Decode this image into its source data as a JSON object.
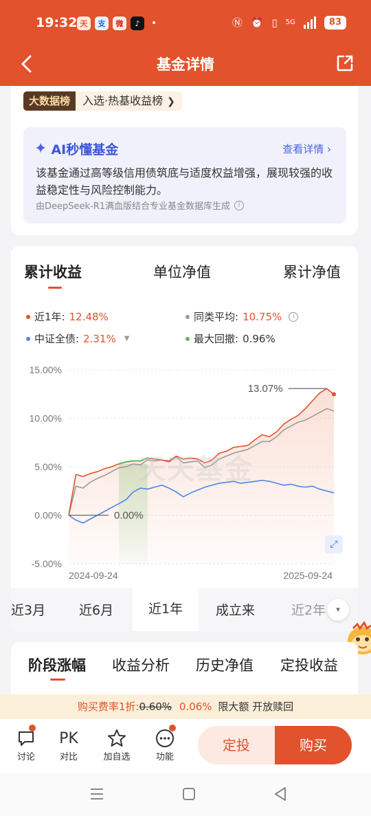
{
  "status_bar": {
    "time": "19:32",
    "network": "5G",
    "battery": "83"
  },
  "nav": {
    "title": "基金详情"
  },
  "ranking": {
    "badge": "大数据榜",
    "text": "入选·热基收益榜"
  },
  "ai": {
    "title": "AI秒懂基金",
    "more": "查看详情",
    "description": "该基金通过高等级信用债筑底与适度权益增强，展现较强的收益稳定性与风险控制能力。",
    "footer": "由DeepSeek-R1满血版结合专业基金数据库生成"
  },
  "chart_tabs": [
    "累计收益",
    "单位净值",
    "累计净值"
  ],
  "legend": {
    "fund_label": "近1年:",
    "fund_value": "12.48%",
    "peer_label": "同类平均:",
    "peer_value": "10.75%",
    "index_label": "中证全债:",
    "index_value": "2.31%",
    "drawdown_label": "最大回撤:",
    "drawdown_value": "0.96%"
  },
  "chart_data": {
    "type": "line",
    "y_ticks": [
      "15.00%",
      "10.00%",
      "5.00%",
      "0.00%",
      "-5.00%"
    ],
    "ylim": [
      -5,
      15
    ],
    "x_labels": [
      "2024-09-24",
      "2025-09-24"
    ],
    "annotations": {
      "max_label": "13.07%",
      "start_label": "0.00%"
    },
    "watermark": "天天基金",
    "series": [
      {
        "name": "近1年",
        "color": "#e2522c",
        "values": [
          0,
          4.2,
          4.0,
          4.3,
          4.5,
          4.8,
          5.0,
          5.3,
          5.5,
          5.6,
          5.6,
          5.9,
          5.8,
          5.7,
          5.6,
          6.1,
          5.8,
          5.9,
          5.8,
          5.4,
          5.7,
          6.4,
          6.6,
          7.0,
          7.1,
          7.2,
          7.8,
          8.3,
          8.1,
          8.6,
          9.4,
          9.9,
          10.3,
          11.0,
          11.8,
          12.6,
          13.07,
          12.48
        ]
      },
      {
        "name": "同类平均",
        "color": "#9a9a9a",
        "values": [
          0,
          3.0,
          2.8,
          3.4,
          3.8,
          4.1,
          4.5,
          4.9,
          5.0,
          5.3,
          5.2,
          5.7,
          5.6,
          5.7,
          5.5,
          6.0,
          5.4,
          5.5,
          5.6,
          4.9,
          5.2,
          5.8,
          6.1,
          6.4,
          6.6,
          6.8,
          7.2,
          7.6,
          7.6,
          8.1,
          8.8,
          9.2,
          9.6,
          9.8,
          10.2,
          10.6,
          11.0,
          10.75
        ]
      },
      {
        "name": "中证全债",
        "color": "#4a86e8",
        "values": [
          0,
          -0.5,
          -0.8,
          -0.4,
          0,
          0.4,
          0.8,
          1.2,
          1.6,
          2.4,
          2.8,
          2.7,
          2.9,
          3.1,
          2.8,
          2.4,
          1.9,
          2.3,
          2.6,
          2.9,
          3.1,
          3.3,
          3.4,
          3.5,
          3.3,
          3.4,
          3.5,
          3.6,
          3.5,
          3.3,
          3.1,
          3.2,
          3.0,
          2.9,
          3.0,
          2.7,
          2.5,
          2.31
        ]
      }
    ],
    "drawdown_region": {
      "start_index": 7,
      "end_index": 11
    }
  },
  "period_tabs": [
    "近3月",
    "近6月",
    "近1年",
    "成立来",
    "近2年"
  ],
  "section_tabs": [
    "阶段涨幅",
    "收益分析",
    "历史净值",
    "定投收益"
  ],
  "fee": {
    "prefix": "购买费率1折:",
    "old": "0.60%",
    "new": "0.06%",
    "suffix": "限大额 开放赎回"
  },
  "bottom_bar": {
    "items": [
      "讨论",
      "对比",
      "加自选",
      "功能"
    ],
    "pk": "PK",
    "dingtou": "定投",
    "buy": "购买"
  }
}
